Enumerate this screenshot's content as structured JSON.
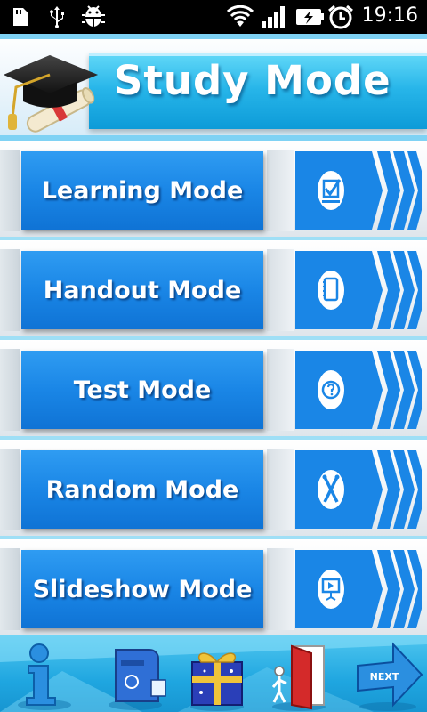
{
  "status_bar": {
    "time": "19:16",
    "icons": [
      "sd-card-icon",
      "usb-icon",
      "android-debug-icon",
      "wifi-icon",
      "signal-icon",
      "battery-charging-icon",
      "alarm-icon"
    ]
  },
  "header": {
    "title": "Study Mode",
    "logo": "graduation-cap-diploma-icon"
  },
  "modes": [
    {
      "label": "Learning Mode",
      "icon": "checkbox-icon"
    },
    {
      "label": "Handout Mode",
      "icon": "notebook-icon"
    },
    {
      "label": "Test Mode",
      "icon": "question-icon"
    },
    {
      "label": "Random Mode",
      "icon": "random-icon"
    },
    {
      "label": "Slideshow Mode",
      "icon": "slideshow-icon"
    }
  ],
  "bottom_bar": {
    "items": [
      "info-icon",
      "mailbox-icon",
      "gift-icon",
      "exit-door-icon",
      "next-arrow-icon"
    ],
    "next_label": "NEXT"
  },
  "colors": {
    "header_band": "#27b5e9",
    "button_blue": "#1a86e6",
    "separator": "#9fdff6",
    "bottom_bar": "#1fa6e0"
  }
}
